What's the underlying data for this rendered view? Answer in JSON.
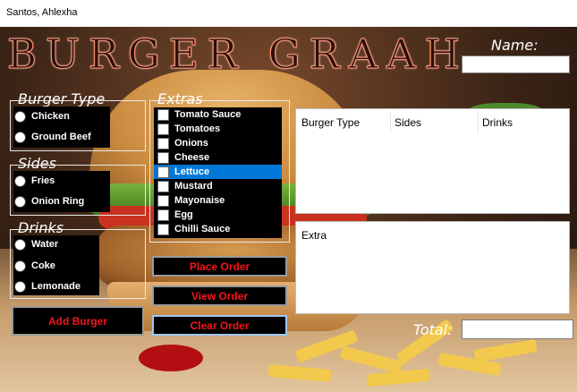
{
  "window": {
    "title": "Santos, Ahlexha"
  },
  "app": {
    "logo_text": "BURGER GRAAH"
  },
  "name": {
    "label": "Name:",
    "value": ""
  },
  "burger_type": {
    "legend": "Burger Type",
    "options": [
      "Chicken",
      "Ground Beef"
    ]
  },
  "sides": {
    "legend": "Sides",
    "options": [
      "Fries",
      "Onion Ring"
    ]
  },
  "drinks": {
    "legend": "Drinks",
    "options": [
      "Water",
      "Coke",
      "Lemonade"
    ]
  },
  "extras": {
    "legend": "Extras",
    "items": [
      "Tomato Sauce",
      "Tomatoes",
      "Onions",
      "Cheese",
      "Lettuce",
      "Mustard",
      "Mayonaise",
      "Egg",
      "Chilli Sauce"
    ],
    "selected": "Lettuce"
  },
  "buttons": {
    "add_burger": "Add Burger",
    "place_order": "Place Order",
    "view_order": "View Order",
    "clear_order": "Clear Order"
  },
  "order_table": {
    "columns": [
      "Burger Type",
      "Sides",
      "Drinks"
    ]
  },
  "extra_panel": {
    "label": "Extra"
  },
  "total": {
    "label": "Total:",
    "value": ""
  },
  "colors": {
    "button_text": "#f4161b",
    "selection": "#0078d7"
  }
}
